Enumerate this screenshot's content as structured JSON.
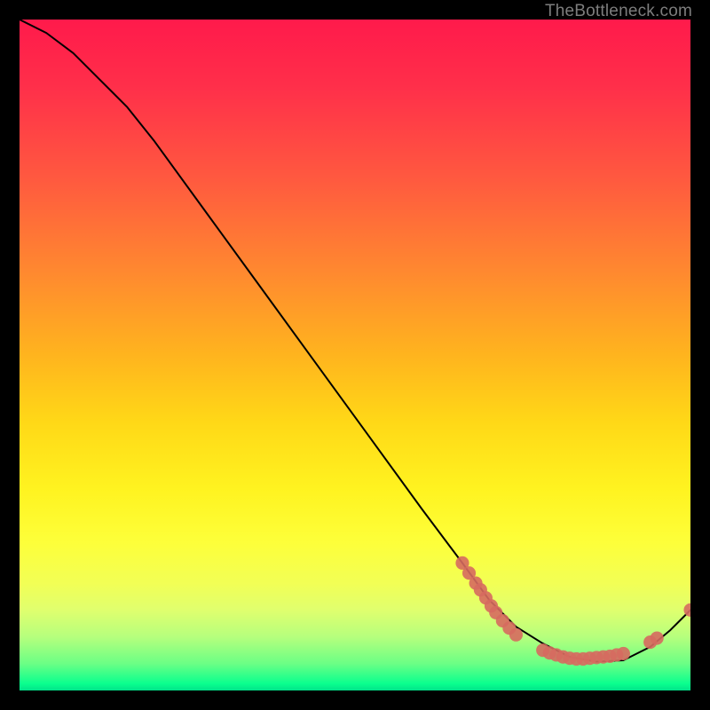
{
  "watermark": "TheBottleneck.com",
  "chart_data": {
    "type": "line",
    "title": "",
    "xlabel": "",
    "ylabel": "",
    "xlim": [
      0,
      100
    ],
    "ylim": [
      0,
      100
    ],
    "grid": false,
    "legend": false,
    "series": [
      {
        "name": "curve",
        "x": [
          0,
          4,
          8,
          12,
          16,
          20,
          28,
          36,
          44,
          52,
          60,
          66,
          70,
          74,
          78,
          82,
          86,
          90,
          94,
          97,
          100
        ],
        "y": [
          100,
          98,
          95,
          91,
          87,
          82,
          71,
          60,
          49,
          38,
          27,
          19,
          13.5,
          9.5,
          7,
          5,
          4.3,
          4.5,
          6.5,
          9,
          12
        ],
        "color": "#000000"
      }
    ],
    "markers": [
      {
        "name": "cluster",
        "color": "#d66a5f",
        "r": 1.0,
        "points": [
          [
            66,
            19.0
          ],
          [
            67,
            17.5
          ],
          [
            68,
            16.0
          ],
          [
            68.7,
            15.0
          ],
          [
            69.5,
            13.8
          ],
          [
            70.3,
            12.6
          ],
          [
            71,
            11.6
          ],
          [
            72,
            10.4
          ],
          [
            73,
            9.3
          ],
          [
            74,
            8.3
          ],
          [
            78,
            6.0
          ],
          [
            79,
            5.6
          ],
          [
            80,
            5.3
          ],
          [
            81,
            5.0
          ],
          [
            82,
            4.8
          ],
          [
            83,
            4.7
          ],
          [
            84,
            4.7
          ],
          [
            85,
            4.8
          ],
          [
            86,
            4.9
          ],
          [
            87,
            5.0
          ],
          [
            88,
            5.1
          ],
          [
            89,
            5.3
          ],
          [
            90,
            5.5
          ],
          [
            94,
            7.2
          ],
          [
            95,
            7.8
          ],
          [
            100,
            12.0
          ]
        ]
      }
    ]
  }
}
